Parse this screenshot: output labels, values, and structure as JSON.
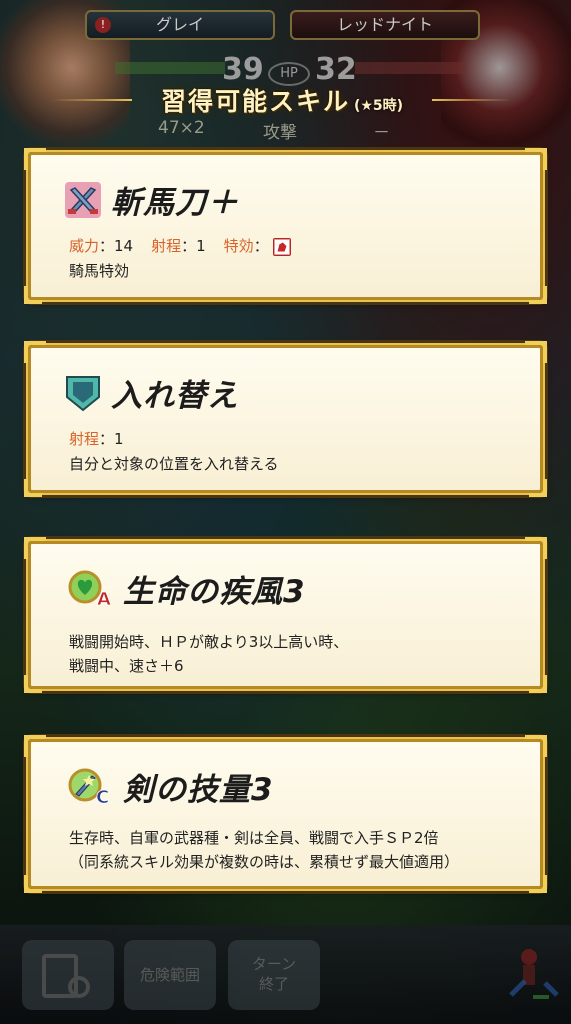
{
  "header": {
    "left_unit_name": "グレイ",
    "right_unit_name": "レッドナイト",
    "left_hp": "39",
    "right_hp": "32",
    "hp_label": "HP",
    "left_attack": "47×2",
    "attack_label": "攻撃",
    "right_attack": "－"
  },
  "title": {
    "text": "習得可能スキル",
    "sub": "(★5時)"
  },
  "skills": [
    {
      "name": "斬馬刀＋",
      "icon": "weapon-swords-icon",
      "stats": {
        "might_label": "威力",
        "might": "：14",
        "range_label": "射程",
        "range": "：1",
        "effective_label": "特効",
        "effective": "："
      },
      "description": "騎馬特効"
    },
    {
      "name": "入れ替え",
      "icon": "assist-shield-icon",
      "stats": {
        "range_label": "射程",
        "range": "：1"
      },
      "description": "自分と対象の位置を入れ替える"
    },
    {
      "name": "生命の疾風3",
      "icon": "passive-a-icon",
      "description_line1": "戦闘開始時、ＨＰが敵より3以上高い時、",
      "description_line2": "戦闘中、速さ＋6"
    },
    {
      "name": "剣の技量3",
      "icon": "passive-c-icon",
      "description_line1": "生存時、自軍の武器種・剣は全員、戦闘で入手ＳＰ2倍",
      "description_line2": "（同系統スキル効果が複数の時は、累積せず最大値適用）"
    }
  ],
  "bottom_menu": {
    "danger_area": "危険範囲",
    "end_turn_line1": "ターン",
    "end_turn_line2": "終了"
  }
}
